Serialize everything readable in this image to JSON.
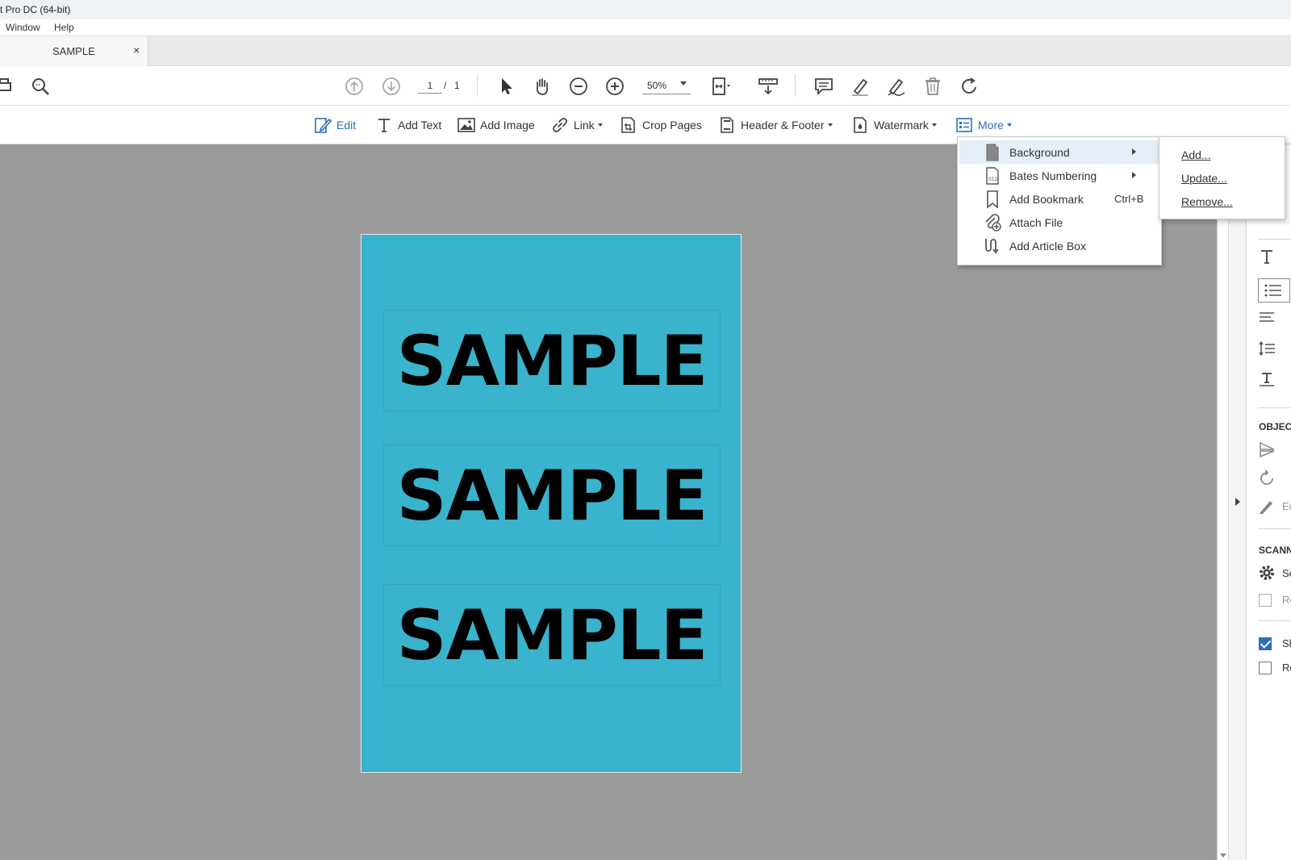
{
  "window": {
    "title": "t Pro DC (64-bit)"
  },
  "menubar": {
    "items": [
      "Window",
      "Help"
    ]
  },
  "tabs": [
    {
      "label": "SAMPLE",
      "close_glyph": "×"
    }
  ],
  "toolbar": {
    "page_current": "1",
    "page_separator": "/",
    "page_total": "1",
    "zoom": "50%",
    "icons": [
      "print-icon",
      "zoom-search-icon",
      "prev-page-icon",
      "next-page-icon",
      "select-cursor-icon",
      "hand-icon",
      "zoom-out-icon",
      "zoom-in-icon",
      "page-fit-icon",
      "scroll-mode-icon",
      "comment-icon",
      "highlight-icon",
      "sign-icon",
      "delete-icon",
      "rotate-icon"
    ]
  },
  "edit_toolbar": {
    "edit": "Edit",
    "add_text": "Add Text",
    "add_image": "Add Image",
    "link": "Link",
    "crop_pages": "Crop Pages",
    "header_footer": "Header & Footer",
    "watermark": "Watermark",
    "more": "More"
  },
  "document": {
    "blocks": [
      "SAMPLE",
      "SAMPLE",
      "SAMPLE"
    ],
    "background_color": "#3ab3cc"
  },
  "more_menu": {
    "items": [
      {
        "label": "Background",
        "icon": "page-icon",
        "has_submenu": true
      },
      {
        "label": "Bates Numbering",
        "icon": "bates-icon",
        "has_submenu": true
      },
      {
        "label": "Add Bookmark",
        "icon": "bookmark-icon",
        "shortcut": "Ctrl+B"
      },
      {
        "label": "Attach File",
        "icon": "paperclip-icon"
      },
      {
        "label": "Add Article Box",
        "icon": "article-box-icon"
      }
    ]
  },
  "background_submenu": {
    "items": [
      "Add...",
      "Update...",
      "Remove..."
    ]
  },
  "right_panel": {
    "objects_heading": "OBJECT",
    "edit_label": "Ed",
    "scanned_heading": "SCANN",
    "settings_label": "Se",
    "recognize_label": "Re",
    "show_label": "Sh",
    "restore_label": "Re",
    "accent_color": "#2a6fbf"
  }
}
